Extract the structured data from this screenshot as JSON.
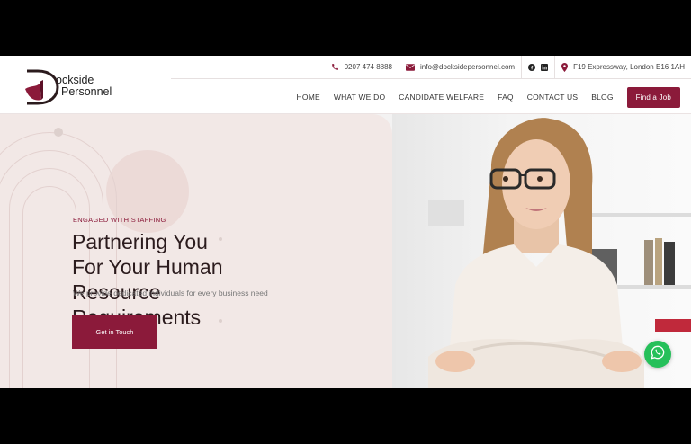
{
  "topbar": {
    "phone": "0207 474 8888",
    "email": "info@docksidepersonnel.com",
    "address": "F19 Expressway, London E16 1AH"
  },
  "logo": {
    "line1": "ockside",
    "line2": "Personnel"
  },
  "nav": {
    "items": [
      "HOME",
      "WHAT WE DO",
      "CANDIDATE WELFARE",
      "FAQ",
      "CONTACT US",
      "BLOG"
    ],
    "cta": "Find a Job"
  },
  "hero": {
    "eyebrow": "ENGAGED WITH STAFFING",
    "headline_lines": [
      "Partnering You",
      "For Your Human",
      "Resource",
      "Requirements"
    ],
    "subtitle": "We provide dedicated individuals for every business need",
    "cta": "Get in Touch"
  },
  "colors": {
    "brand": "#8b1a3a",
    "hero_bg": "#f2e8e6",
    "whatsapp": "#25c05a"
  }
}
